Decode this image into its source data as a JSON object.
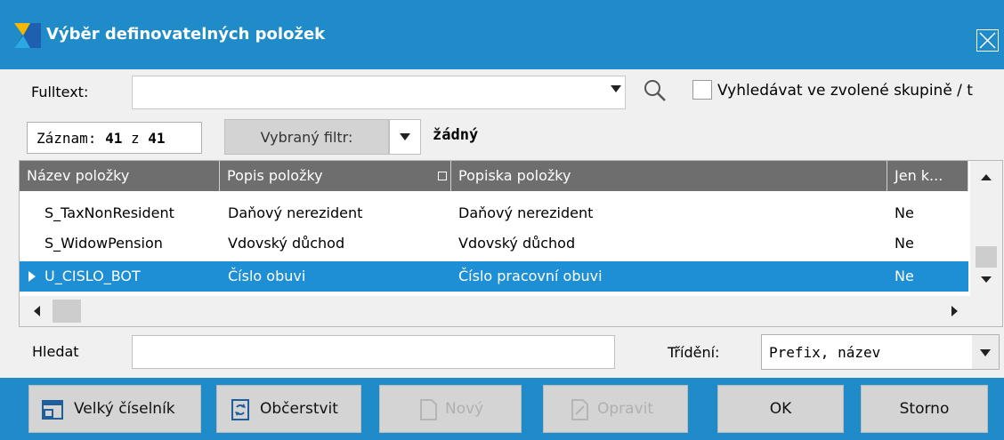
{
  "window": {
    "title": "Výběr definovatelných položek",
    "close_icon": "close-icon"
  },
  "fulltext": {
    "label": "Fulltext:",
    "value": "",
    "search_icon": "search-icon",
    "checkbox_label": "Vyhledávat ve zvolené skupině / t",
    "checkbox_checked": false
  },
  "record": {
    "label": "Záznam:",
    "current": "41",
    "sep": "z",
    "total": "41"
  },
  "filter": {
    "button_label": "Vybraný filtr:",
    "value": "žádný"
  },
  "grid": {
    "columns": [
      "Název položky",
      "Popis položky",
      "Popiska položky",
      "Jen k..."
    ],
    "rows": [
      {
        "name": "S_TaxNonResident",
        "desc": "Daňový nerezident",
        "label": "Daňový nerezident",
        "only": "Ne",
        "selected": false
      },
      {
        "name": "S_WidowPension",
        "desc": "Vdovský důchod",
        "label": "Vdovský důchod",
        "only": "Ne",
        "selected": false
      },
      {
        "name": "U_CISLO_BOT",
        "desc": "Číslo obuvi",
        "label": "Číslo pracovní obuvi",
        "only": "Ne",
        "selected": true
      }
    ]
  },
  "search": {
    "label": "Hledat",
    "value": ""
  },
  "sort": {
    "label": "Třídění:",
    "value": "Prefix, název"
  },
  "toolbar": {
    "big_list": "Velký číselník",
    "refresh": "Občerstvit",
    "new": "Nový",
    "edit": "Opravit",
    "ok": "OK",
    "cancel": "Storno"
  },
  "colors": {
    "accent": "#1f8bc8",
    "selection": "#1e8fd4",
    "header": "#6e6e6e"
  }
}
